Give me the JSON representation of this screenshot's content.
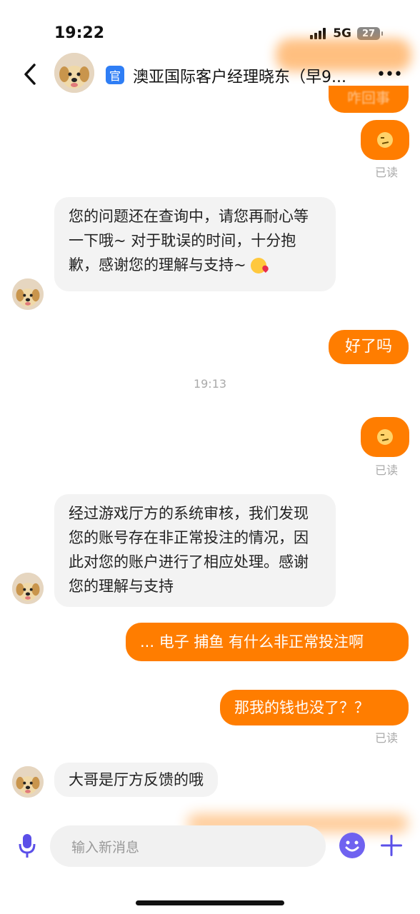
{
  "status": {
    "time": "19:22",
    "network": "5G",
    "battery": "27"
  },
  "header": {
    "badge": "官",
    "title": "澳亚国际客户经理晓东（早9...",
    "more": "•••"
  },
  "messages": {
    "m1_partial": "咋回事",
    "read_1": "已读",
    "m2_text": "您的问题还在查询中，请您再耐心等一下哦~ 对于耽误的时间，十分抱歉，感谢您的理解与支持~",
    "m3": "好了吗",
    "divider": "19:13",
    "read_2": "已读",
    "m4_text": " 经过游戏厅方的系统审核，我们发现您的账号存在非正常投注的情况，因此对您的账户进行了相应处理。感谢您的理解与支持",
    "m5": "... 电子 捕鱼 有什么非正常投注啊",
    "m6": "那我的钱也没了？？",
    "read_3": "已读",
    "m7": "大哥是厅方反馈的哦"
  },
  "input": {
    "placeholder": "输入新消息"
  },
  "colors": {
    "accent_orange": "#ff7d00",
    "bubble_gray": "#f3f3f3",
    "official_blue": "#2f7ef5",
    "emoji_purple": "#6f62f0"
  },
  "icons": [
    "back-arrow-icon",
    "official-badge-icon",
    "more-icon",
    "mic-icon",
    "emoji-icon",
    "plus-icon"
  ]
}
